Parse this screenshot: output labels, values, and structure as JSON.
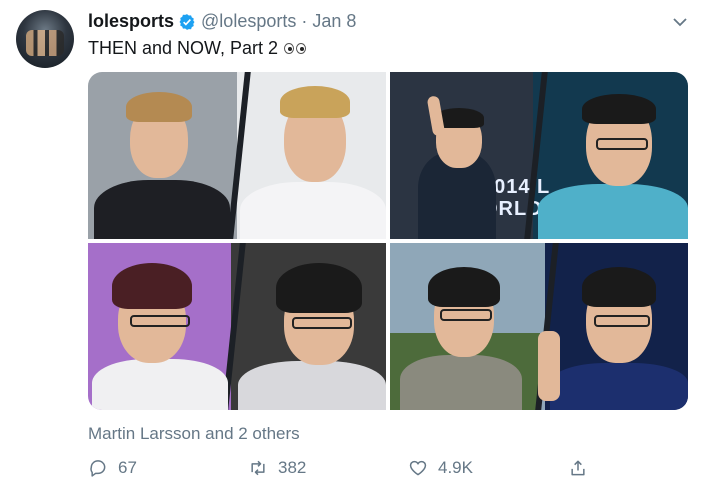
{
  "tweet": {
    "display_name": "lolesports",
    "handle": "@lolesports",
    "separator": "·",
    "date": "Jan 8",
    "text": "THEN and NOW, Part 2",
    "emoji": "eyes-emoji",
    "verified": true
  },
  "media": {
    "photos": [
      {
        "id": "photo-1"
      },
      {
        "id": "photo-2",
        "banner": "2014 L\nORLD"
      },
      {
        "id": "photo-3"
      },
      {
        "id": "photo-4"
      }
    ]
  },
  "likers_text": "Martin Larsson and 2 others",
  "actions": {
    "reply": {
      "icon": "reply-icon",
      "count": "67"
    },
    "retweet": {
      "icon": "retweet-icon",
      "count": "382"
    },
    "like": {
      "icon": "heart-icon",
      "count": "4.9K"
    },
    "share": {
      "icon": "share-icon"
    }
  },
  "colors": {
    "verified": "#1da1f2",
    "secondary_text": "#657786",
    "primary_text": "#14171a"
  }
}
